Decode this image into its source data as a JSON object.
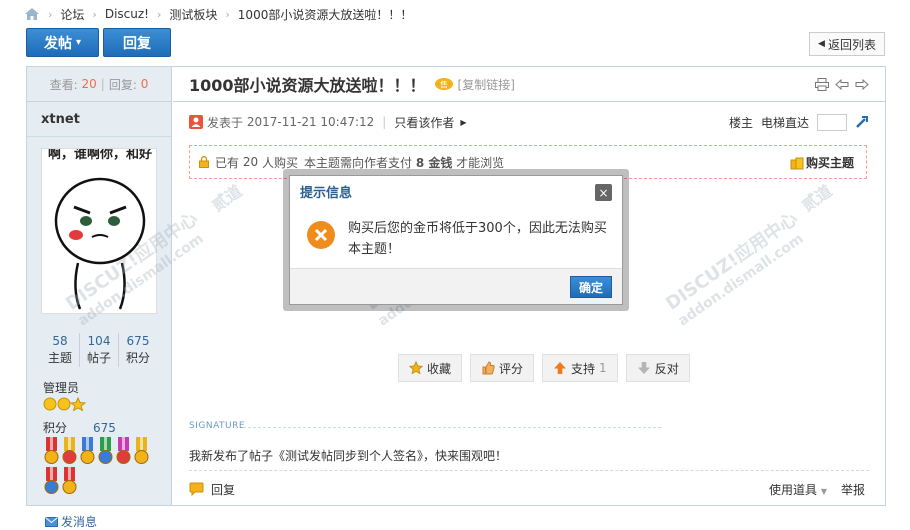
{
  "breadcrumb": {
    "items": [
      "论坛",
      "Discuz!",
      "测试板块",
      "1000部小说资源大放送啦！！！"
    ],
    "sep": "›"
  },
  "toolbar": {
    "post_label": "发帖",
    "post_arrow": "▾",
    "reply_label": "回复",
    "back_label": "返回列表"
  },
  "sidebar": {
    "views_label": "查看:",
    "views": "20",
    "replies_label": "回复:",
    "replies": "0",
    "author": "xtnet",
    "stats": [
      {
        "num": "58",
        "label": "主题"
      },
      {
        "num": "104",
        "label": "帖子"
      },
      {
        "num": "675",
        "label": "积分"
      }
    ],
    "group": "管理员",
    "points_label": "积分",
    "points": "675",
    "message_link": "发消息",
    "avatar_text": "啊，谁啊你，和好"
  },
  "post": {
    "title": "1000部小说资源大放送啦！！！",
    "copy_link": "[复制链接]",
    "posted_prefix": "发表于",
    "posted_time": "2017-11-21 10:47:12",
    "only_author": "只看该作者",
    "floor": "楼主",
    "elevator": "电梯直达",
    "buy_bought_pre": "已有",
    "buy_count": "20",
    "buy_bought_post": "人购买",
    "buy_notice_pre": "本主题需向作者支付",
    "buy_price": "8 金钱",
    "buy_notice_post": "才能浏览",
    "buy_button": "购买主题",
    "actions": [
      {
        "label": "收藏",
        "count": ""
      },
      {
        "label": "评分",
        "count": ""
      },
      {
        "label": "支持",
        "count": "1"
      },
      {
        "label": "反对",
        "count": ""
      }
    ],
    "signature_label": "SIGNATURE",
    "signature_text": "我新发布了帖子《测试发帖同步到个人签名》，快来围观吧！",
    "reply_link": "回复",
    "tools_label": "使用道具",
    "report_label": "举报"
  },
  "dialog": {
    "title": "提示信息",
    "close": "×",
    "message": "购买后您的金币将低于300个，因此无法购买本主题！",
    "ok_label": "确定"
  },
  "watermark": {
    "brand": "DISCUZ!应用中心",
    "site": "addon.dismall.com",
    "sub": "贰道"
  },
  "colors": {
    "primary": "#1f6cb8",
    "sidebar": "#e5edf2",
    "border": "#c2d5e3",
    "accent_red": "#f26c4f",
    "link": "#336699"
  }
}
